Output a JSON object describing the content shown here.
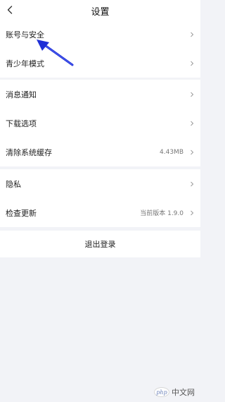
{
  "header": {
    "title": "设置",
    "back_icon": "chevron-left-icon"
  },
  "groups": [
    {
      "items": [
        {
          "label": "账号与安全",
          "value": ""
        },
        {
          "label": "青少年模式",
          "value": ""
        }
      ]
    },
    {
      "items": [
        {
          "label": "消息通知",
          "value": ""
        },
        {
          "label": "下载选项",
          "value": ""
        },
        {
          "label": "清除系统缓存",
          "value": "4.43MB"
        }
      ]
    },
    {
      "items": [
        {
          "label": "隐私",
          "value": ""
        },
        {
          "label": "检查更新",
          "value": "当前版本 1.9.0"
        }
      ]
    }
  ],
  "logout": {
    "label": "退出登录"
  },
  "annotation": {
    "icon": "blue-arrow-icon",
    "color": "#1f2fd6"
  },
  "watermark": {
    "text": "中文网",
    "logo_text": "php"
  },
  "colors": {
    "background": "#f2f3f7",
    "surface": "#ffffff",
    "chevron": "#9a9a9a"
  }
}
